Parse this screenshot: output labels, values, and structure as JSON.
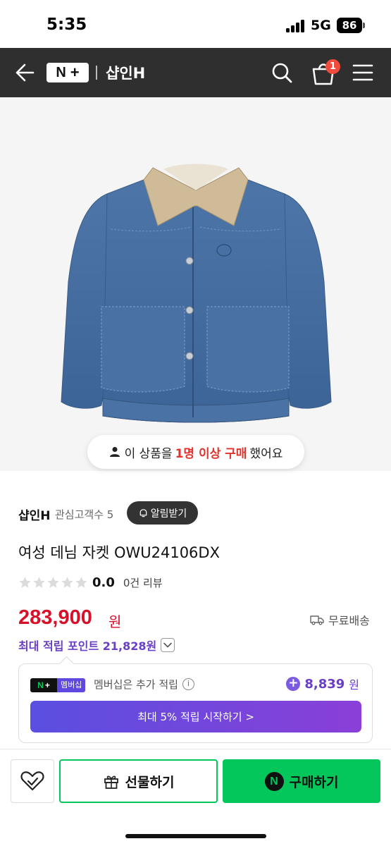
{
  "status_bar": {
    "time": "5:35",
    "network": "5G",
    "battery": "86"
  },
  "header": {
    "logo_n": "N",
    "logo_plus": "+",
    "title": "샵인H",
    "cart_count": "1"
  },
  "product": {
    "purchase_notice": {
      "before": "이 상품을",
      "highlight": "1명 이상 구매",
      "after": "했어요"
    },
    "store_name": "샵인H",
    "store_fans": "관심고객수 5",
    "alarm_label": "알림받기",
    "title": "여성 데님 자켓 OWU24106DX",
    "rating": {
      "stars": 0,
      "max": 5,
      "value": "0.0",
      "review_count": "0건 리뷰"
    },
    "price": "283,900",
    "price_unit": "원",
    "shipping": "무료배송",
    "max_points": "최대 적립 포인트 21,828원"
  },
  "membership": {
    "badge_label": "멤버십",
    "description": "멤버십은 추가 적립",
    "info_symbol": "i",
    "points_prefix": "+",
    "points": "8,839",
    "points_unit": "원",
    "cta": "최대 5% 적립 시작하기 >"
  },
  "bottom_bar": {
    "gift_label": "선물하기",
    "buy_label": "구매하기",
    "npay_symbol": "N"
  },
  "colors": {
    "header_bg": "#2f2f2f",
    "price": "#d8112b",
    "points": "#6a3fc7",
    "naver_green": "#03c75a",
    "badge_red": "#f04c3e"
  }
}
